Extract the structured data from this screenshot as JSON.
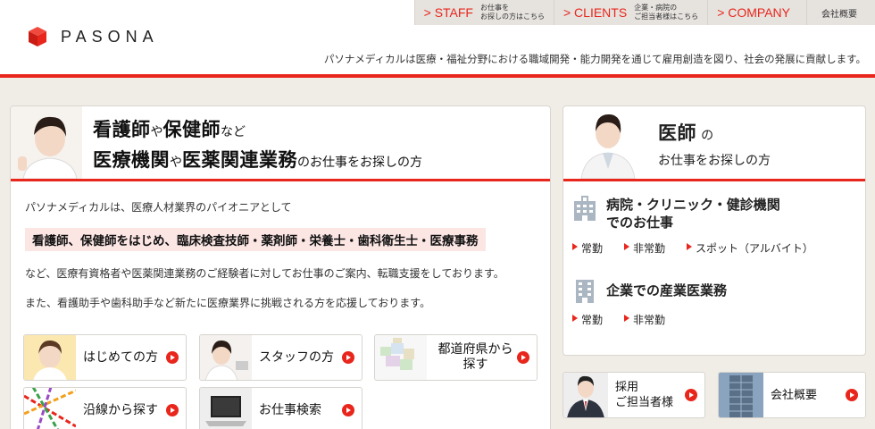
{
  "header": {
    "logo_text": "PASONA",
    "tagline": "パソナメディカルは医療・福祉分野における職域開発・能力開発を通じて雇用創造を図り、社会の発展に貢献します。",
    "nav": [
      {
        "label": "> STAFF",
        "sub": "お仕事を\nお探しの方はこちら"
      },
      {
        "label": "> CLIENTS",
        "sub": "企業・病院の\nご担当者様はこちら"
      },
      {
        "label": "> COMPANY",
        "sub": ""
      }
    ],
    "corp_link": "会社概要"
  },
  "left": {
    "title_line1_big1": "看護師",
    "title_line1_small1": "や",
    "title_line1_big2": "保健師",
    "title_line1_small2": "など",
    "title_line2_big1": "医療機関",
    "title_line2_small1": "や",
    "title_line2_big2": "医薬関連業務",
    "title_line2_small2": "のお仕事をお探しの方",
    "intro": "パソナメディカルは、医療人材業界のパイオニアとして",
    "highlight": "看護師、保健師をはじめ、臨床検査技師・薬剤師・栄養士・歯科衛生士・医療事務",
    "para2": "など、医療有資格者や医薬関連業務のご経験者に対してお仕事のご案内、転職支援をしております。",
    "para3": "また、看護助手や歯科助手など新たに医療業界に挑戦される方を応援しております。",
    "tiles": [
      {
        "label": "はじめての方"
      },
      {
        "label": "スタッフの方"
      },
      {
        "label": "都道府県から探す"
      },
      {
        "label": "沿線から探す"
      },
      {
        "label": "お仕事検索"
      }
    ]
  },
  "right": {
    "title": "医師",
    "title_small": "の",
    "subtitle": "お仕事をお探しの方",
    "sections": [
      {
        "title": "病院・クリニック・健診機関\nでのお仕事",
        "links": [
          "常勤",
          "非常勤",
          "スポット（アルバイト）"
        ]
      },
      {
        "title": "企業での産業医業務",
        "links": [
          "常勤",
          "非常勤"
        ]
      }
    ],
    "tiles": [
      {
        "label": "採用\nご担当者様"
      },
      {
        "label": "会社概要"
      }
    ]
  },
  "colors": {
    "accent": "#e8261c",
    "background": "#f0ede6",
    "highlight_bg": "#fbe6e4"
  }
}
